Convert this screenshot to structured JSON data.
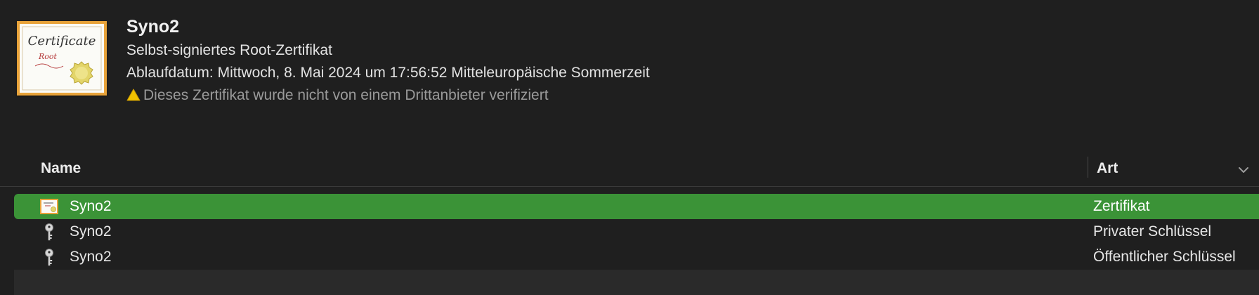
{
  "certificate": {
    "title": "Syno2",
    "subtitle": "Selbst-signiertes Root-Zertifikat",
    "expiry": "Ablaufdatum: Mittwoch, 8. Mai 2024 um 17:56:52 Mitteleuropäische Sommerzeit",
    "warning": "Dieses Zertifikat wurde nicht von einem Drittanbieter verifiziert",
    "icon": "certificate-icon",
    "icon_text": "Certificate",
    "icon_subtext": "Root"
  },
  "columns": {
    "name": "Name",
    "art": "Art"
  },
  "rows": [
    {
      "name": "Syno2",
      "art": "Zertifikat",
      "icon": "certificate-icon",
      "selected": true
    },
    {
      "name": "Syno2",
      "art": "Privater Schlüssel",
      "icon": "key-icon"
    },
    {
      "name": "Syno2",
      "art": "Öffentlicher Schlüssel",
      "icon": "key-icon"
    }
  ],
  "colors": {
    "background": "#1f1f1f",
    "selection": "#3b9337",
    "alt_row": "#2a2a2a",
    "warning": "#f2c200"
  }
}
